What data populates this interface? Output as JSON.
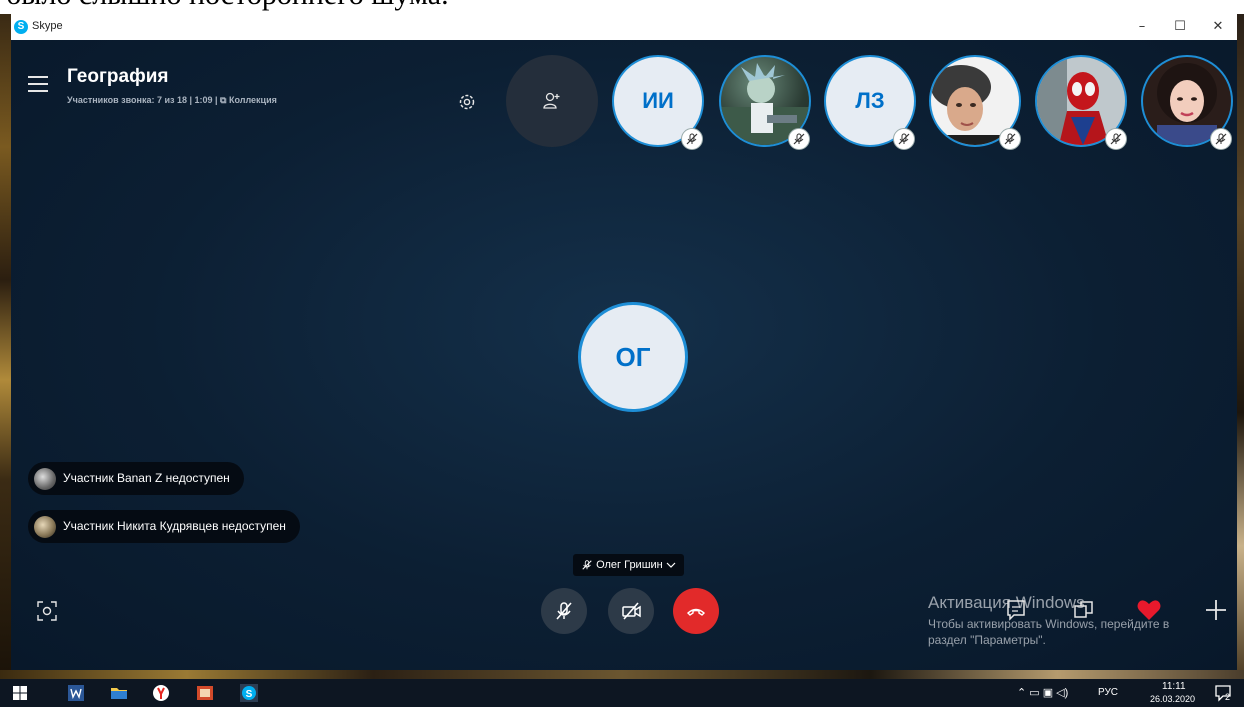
{
  "document": {
    "cutoff_text": "было слышно постороннего шума."
  },
  "window": {
    "title": "Skype",
    "buttons": {
      "minimize": "–",
      "maximize": "☐",
      "close": "✕"
    }
  },
  "call": {
    "title": "География",
    "subtitle": "Участников звонка: 7 из 18 | 1:09 | ⧉ Коллекция",
    "center_participant_initials": "ОГ"
  },
  "participants": [
    {
      "type": "initials",
      "initials": "ИИ",
      "muted": true
    },
    {
      "type": "photo",
      "icon": "cartoon-avatar",
      "muted": true
    },
    {
      "type": "initials",
      "initials": "ЛЗ",
      "muted": true
    },
    {
      "type": "photo",
      "icon": "portrait-avatar",
      "muted": true
    },
    {
      "type": "photo",
      "icon": "spiderman-avatar",
      "muted": true
    },
    {
      "type": "photo",
      "icon": "woman-avatar",
      "muted": true
    }
  ],
  "notifications": [
    {
      "text": "Участник Banan Z недоступен"
    },
    {
      "text": "Участник Никита Кудрявцев недоступен"
    }
  ],
  "active_speaker": {
    "name": "Олег Гришин"
  },
  "controls": {
    "mic": "mic-off-icon",
    "camera": "video-off-icon",
    "end_call": "hang-up-icon"
  },
  "watermark": {
    "title": "Активация Windows",
    "line1": "Чтобы активировать Windows, перейдите в",
    "line2": "раздел \"Параметры\"."
  },
  "taskbar": {
    "language": "РУС",
    "time": "11:11",
    "date": "26.03.2020",
    "notification_count": "2"
  },
  "colors": {
    "call_background": "#0b1a2c",
    "accent": "#1e8ed6",
    "end_call": "#e22a2a",
    "heart": "#e8192c"
  }
}
